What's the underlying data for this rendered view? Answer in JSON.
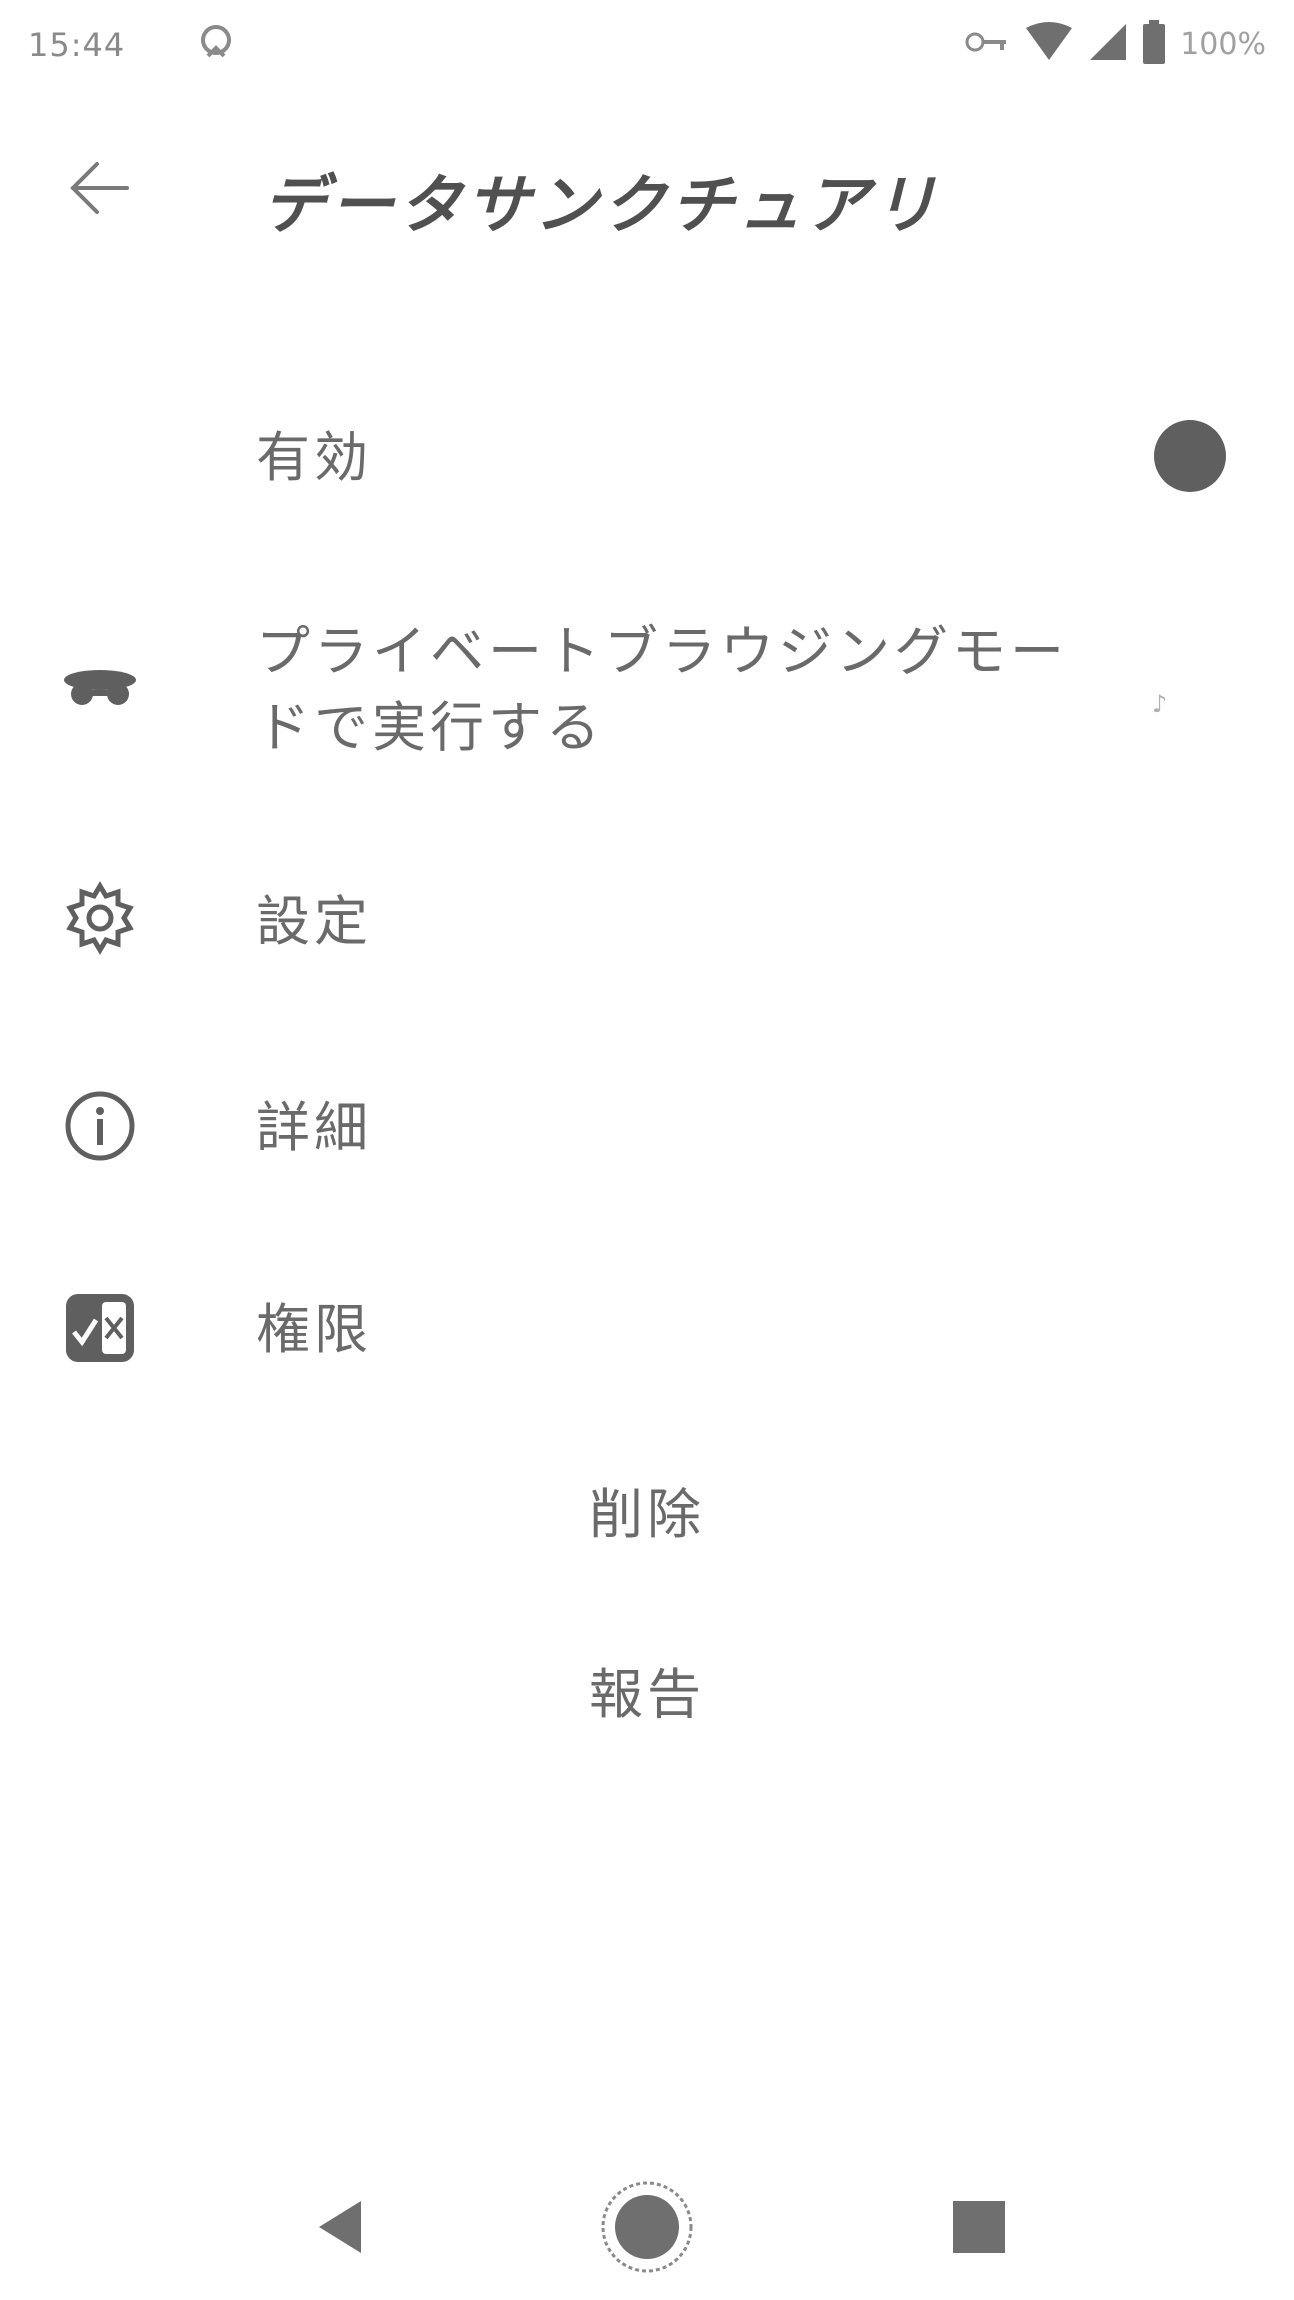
{
  "status_bar": {
    "time": "15:44",
    "battery": "100%",
    "icons": [
      "notification-icon",
      "key-icon",
      "wifi-icon",
      "signal-icon",
      "battery-icon"
    ]
  },
  "app_bar": {
    "title": "データサンクチュアリ",
    "back_icon": "arrow-left-icon"
  },
  "settings": {
    "enabled_label": "有効",
    "private_label_line1": "プライベートブラウジングモー",
    "private_label_line2": "ドで実行する",
    "private_mark": "♪",
    "settings_label": "設定",
    "details_label": "詳細",
    "permissions_label": "権限"
  },
  "actions": {
    "delete_label": "削除",
    "report_label": "報告"
  },
  "colors": {
    "text": "#6a6a6a",
    "icon": "#5f5f5f",
    "background": "#ffffff"
  }
}
